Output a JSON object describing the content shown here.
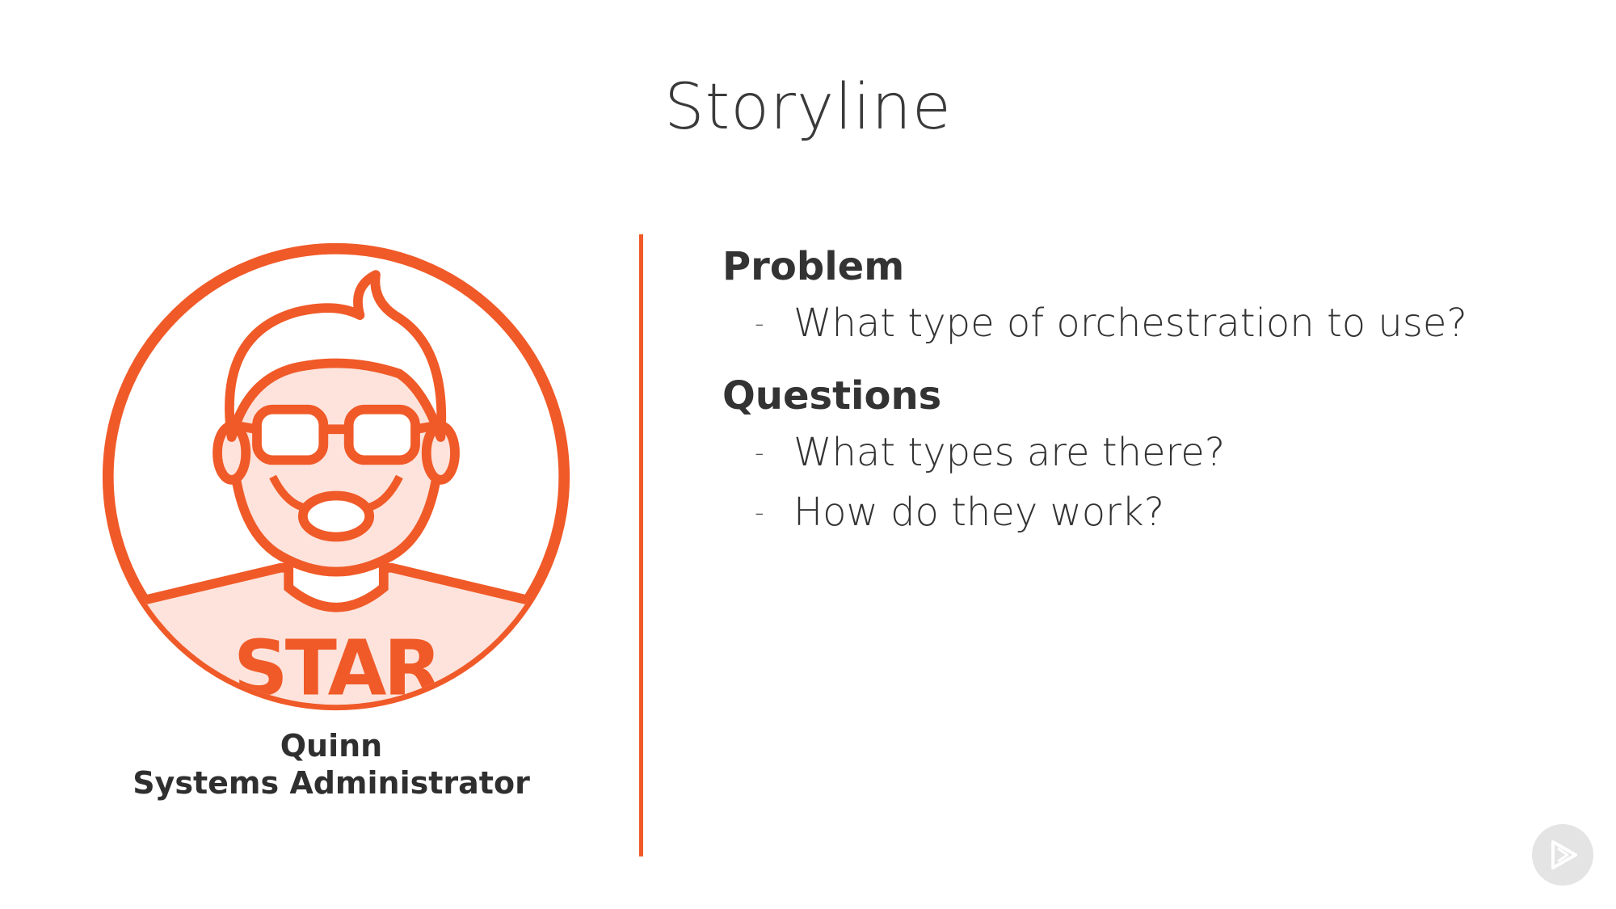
{
  "slide": {
    "title": "Storyline"
  },
  "persona": {
    "name": "Quinn",
    "role": "Systems Administrator",
    "shirt_text": "STAR",
    "accent_color": "#f05a28",
    "fill_color": "#fde3dc"
  },
  "sections": [
    {
      "heading": "Problem",
      "items": [
        "What type of orchestration to use?"
      ]
    },
    {
      "heading": "Questions",
      "items": [
        "What types are there?",
        "How do they work?"
      ]
    }
  ],
  "player": {
    "icon": "play-icon"
  }
}
